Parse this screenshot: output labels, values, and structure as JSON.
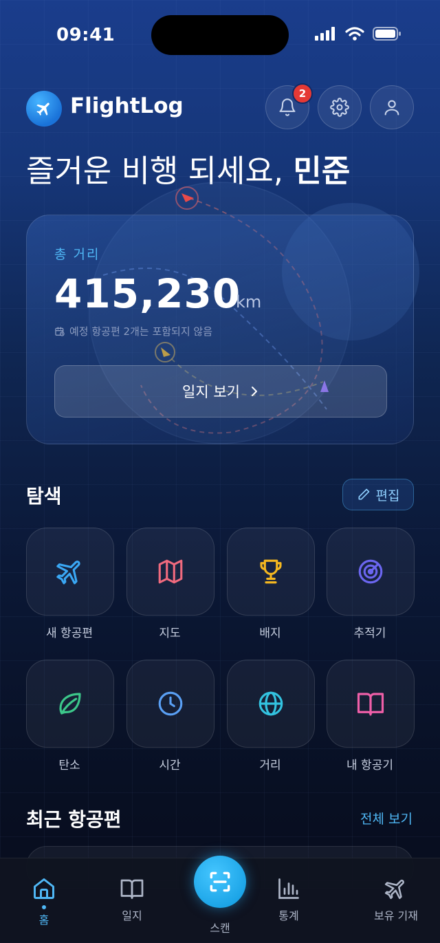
{
  "status_bar": {
    "time": "09:41"
  },
  "header": {
    "app_name": "FlightLog",
    "notification_count": "2",
    "greeting_prefix": "즐거운 비행 되세요, ",
    "greeting_name": "민준"
  },
  "distance_card": {
    "label": "총 거리",
    "value": "415,230",
    "unit": "km",
    "note": "예정 항공편 2개는 포함되지 않음",
    "button_label": "일지 보기"
  },
  "explore": {
    "title": "탐색",
    "edit_label": "편집",
    "tiles": [
      {
        "label": "새 항공편",
        "icon": "plane-icon",
        "color": "#3aa8f5"
      },
      {
        "label": "지도",
        "icon": "map-icon",
        "color": "#f06a7e"
      },
      {
        "label": "배지",
        "icon": "trophy-icon",
        "color": "#f5b820"
      },
      {
        "label": "추적기",
        "icon": "radar-icon",
        "color": "#6b66f0"
      },
      {
        "label": "탄소",
        "icon": "leaf-icon",
        "color": "#3cc78a"
      },
      {
        "label": "시간",
        "icon": "clock-icon",
        "color": "#5aa0f5"
      },
      {
        "label": "거리",
        "icon": "globe-icon",
        "color": "#33c3e0"
      },
      {
        "label": "내 항공기",
        "icon": "book-icon",
        "color": "#ef5fa8"
      }
    ]
  },
  "recent": {
    "title": "최근 항공편",
    "see_all": "전체 보기"
  },
  "tabbar": {
    "home": "홈",
    "logbook": "일지",
    "scan": "스캔",
    "stats": "통계",
    "fleet": "보유 기재"
  },
  "colors": {
    "accent": "#4fb7f5",
    "badge": "#e53935"
  }
}
